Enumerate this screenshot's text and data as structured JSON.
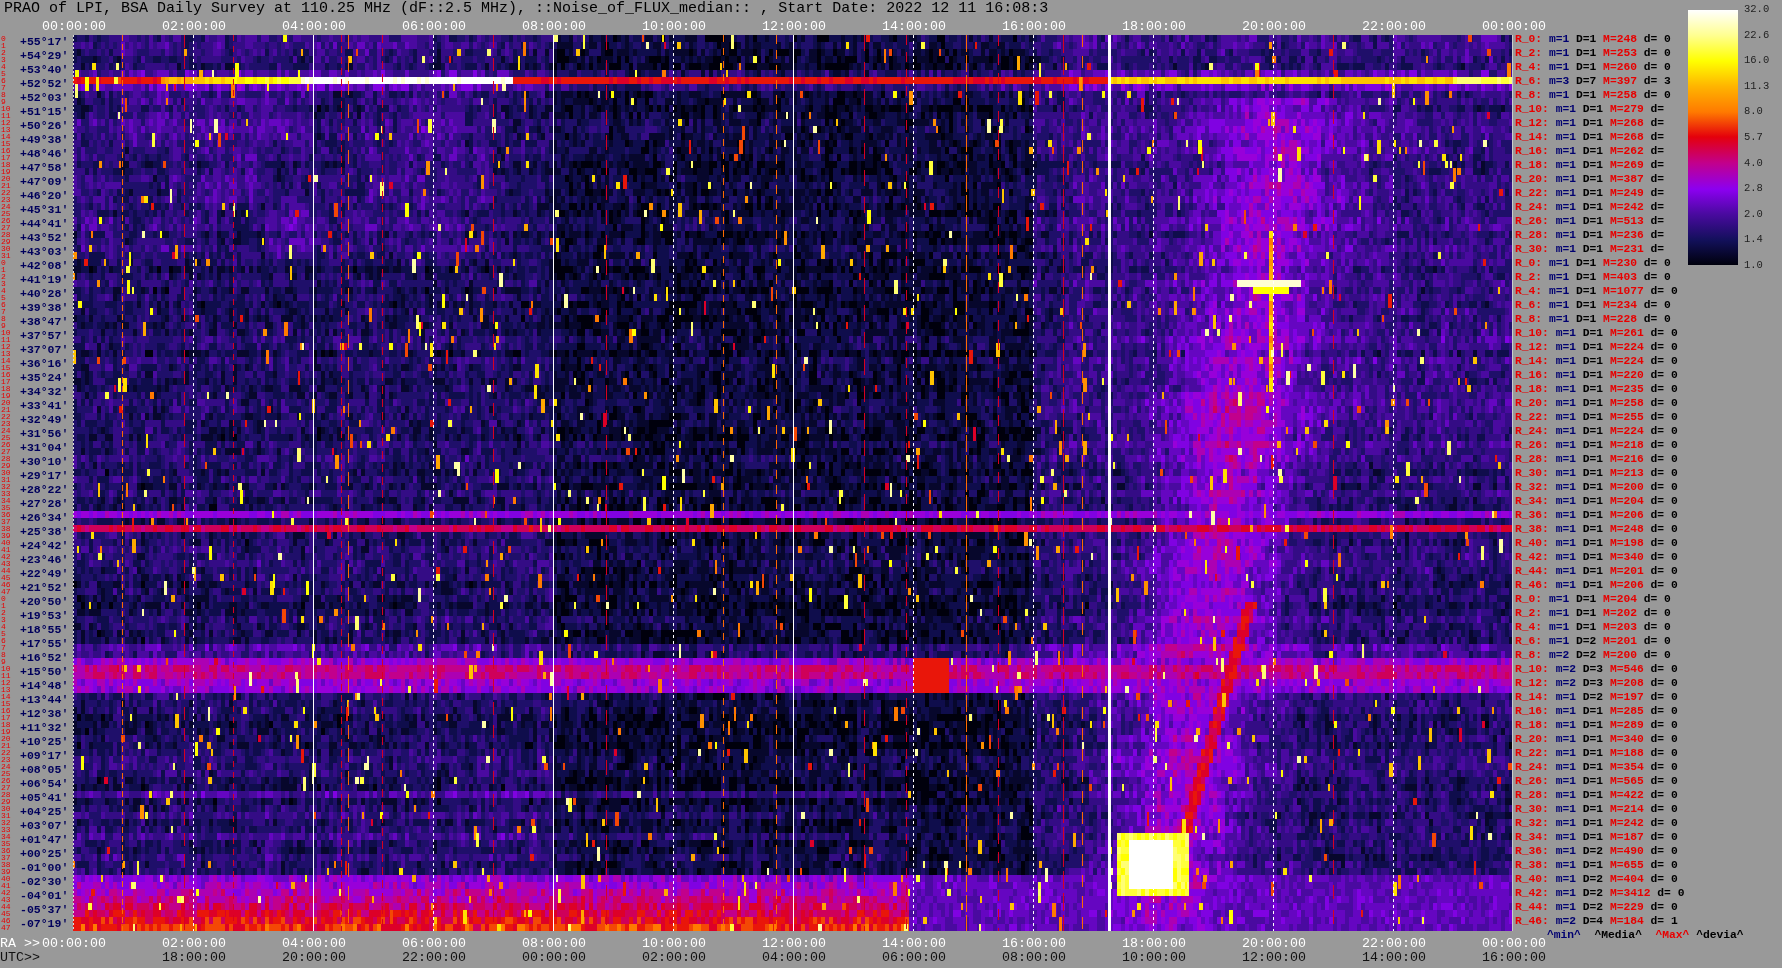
{
  "title": "PRAO of LPI, BSA Daily Survey at 110.25 MHz (dF::2.5 MHz), ::Noise_of_FLUX_median:: , Start Date: 2022 12 11 16:08:3",
  "top_time_axis": [
    "00:00:00",
    "02:00:00",
    "04:00:00",
    "06:00:00",
    "08:00:00",
    "10:00:00",
    "12:00:00",
    "14:00:00",
    "16:00:00",
    "18:00:00",
    "20:00:00",
    "22:00:00",
    "00:00:00"
  ],
  "blocks": [
    {
      "beam_numbers": [
        "0",
        "1",
        "2",
        "3",
        "4",
        "5",
        "6",
        "7",
        "8",
        "9",
        "10",
        "11",
        "12",
        "13",
        "14",
        "15",
        "16",
        "17",
        "18",
        "19",
        "20",
        "21",
        "22",
        "23",
        "24",
        "25",
        "26",
        "27",
        "28",
        "29",
        "30",
        "31"
      ],
      "rows": [
        {
          "declination": "+55°17'",
          "beam": "R_0:",
          "min": "m=1",
          "median": "D=1",
          "max": "M=248",
          "deviation": "d= 0"
        },
        {
          "declination": "+54°29'",
          "beam": "R_2:",
          "min": "m=1",
          "median": "D=1",
          "max": "M=253",
          "deviation": "d= 0"
        },
        {
          "declination": "+53°40'",
          "beam": "R_4:",
          "min": "m=1",
          "median": "D=1",
          "max": "M=260",
          "deviation": "d= 0"
        },
        {
          "declination": "+52°52'",
          "beam": "R_6:",
          "min": "m=3",
          "median": "D=7",
          "max": "M=397",
          "deviation": "d= 3"
        },
        {
          "declination": "+52°03'",
          "beam": "R_8:",
          "min": "m=1",
          "median": "D=1",
          "max": "M=258",
          "deviation": "d= 0"
        },
        {
          "declination": "+51°15'",
          "beam": "R_10:",
          "min": "m=1",
          "median": "D=1",
          "max": "M=279",
          "deviation": "d="
        },
        {
          "declination": "+50°26'",
          "beam": "R_12:",
          "min": "m=1",
          "median": "D=1",
          "max": "M=268",
          "deviation": "d="
        },
        {
          "declination": "+49°38'",
          "beam": "R_14:",
          "min": "m=1",
          "median": "D=1",
          "max": "M=268",
          "deviation": "d="
        },
        {
          "declination": "+48°46'",
          "beam": "R_16:",
          "min": "m=1",
          "median": "D=1",
          "max": "M=262",
          "deviation": "d="
        },
        {
          "declination": "+47°58'",
          "beam": "R_18:",
          "min": "m=1",
          "median": "D=1",
          "max": "M=269",
          "deviation": "d="
        },
        {
          "declination": "+47°09'",
          "beam": "R_20:",
          "min": "m=1",
          "median": "D=1",
          "max": "M=387",
          "deviation": "d="
        },
        {
          "declination": "+46°20'",
          "beam": "R_22:",
          "min": "m=1",
          "median": "D=1",
          "max": "M=249",
          "deviation": "d="
        },
        {
          "declination": "+45°31'",
          "beam": "R_24:",
          "min": "m=1",
          "median": "D=1",
          "max": "M=242",
          "deviation": "d="
        },
        {
          "declination": "+44°41'",
          "beam": "R_26:",
          "min": "m=1",
          "median": "D=1",
          "max": "M=513",
          "deviation": "d="
        },
        {
          "declination": "+43°52'",
          "beam": "R_28:",
          "min": "m=1",
          "median": "D=1",
          "max": "M=236",
          "deviation": "d="
        },
        {
          "declination": "+43°03'",
          "beam": "R_30:",
          "min": "m=1",
          "median": "D=1",
          "max": "M=231",
          "deviation": "d="
        }
      ]
    },
    {
      "beam_numbers": [
        "0",
        "1",
        "2",
        "3",
        "4",
        "5",
        "6",
        "7",
        "8",
        "9",
        "10",
        "11",
        "12",
        "13",
        "14",
        "15",
        "16",
        "17",
        "18",
        "19",
        "20",
        "21",
        "22",
        "23",
        "24",
        "25",
        "26",
        "27",
        "28",
        "29",
        "30",
        "31",
        "32",
        "33",
        "34",
        "35",
        "36",
        "37",
        "38",
        "39",
        "40",
        "41",
        "42",
        "43",
        "44",
        "45",
        "46",
        "47"
      ],
      "rows": [
        {
          "declination": "+42°08'",
          "beam": "R_0:",
          "min": "m=1",
          "median": "D=1",
          "max": "M=230",
          "deviation": "d= 0"
        },
        {
          "declination": "+41°19'",
          "beam": "R_2:",
          "min": "m=1",
          "median": "D=1",
          "max": "M=403",
          "deviation": "d= 0"
        },
        {
          "declination": "+40°28'",
          "beam": "R_4:",
          "min": "m=1",
          "median": "D=1",
          "max": "M=1077",
          "deviation": "d= 0"
        },
        {
          "declination": "+39°38'",
          "beam": "R_6:",
          "min": "m=1",
          "median": "D=1",
          "max": "M=234",
          "deviation": "d= 0"
        },
        {
          "declination": "+38°47'",
          "beam": "R_8:",
          "min": "m=1",
          "median": "D=1",
          "max": "M=228",
          "deviation": "d= 0"
        },
        {
          "declination": "+37°57'",
          "beam": "R_10:",
          "min": "m=1",
          "median": "D=1",
          "max": "M=261",
          "deviation": "d= 0"
        },
        {
          "declination": "+37°07'",
          "beam": "R_12:",
          "min": "m=1",
          "median": "D=1",
          "max": "M=224",
          "deviation": "d= 0"
        },
        {
          "declination": "+36°16'",
          "beam": "R_14:",
          "min": "m=1",
          "median": "D=1",
          "max": "M=224",
          "deviation": "d= 0"
        },
        {
          "declination": "+35°24'",
          "beam": "R_16:",
          "min": "m=1",
          "median": "D=1",
          "max": "M=220",
          "deviation": "d= 0"
        },
        {
          "declination": "+34°32'",
          "beam": "R_18:",
          "min": "m=1",
          "median": "D=1",
          "max": "M=235",
          "deviation": "d= 0"
        },
        {
          "declination": "+33°41'",
          "beam": "R_20:",
          "min": "m=1",
          "median": "D=1",
          "max": "M=258",
          "deviation": "d= 0"
        },
        {
          "declination": "+32°49'",
          "beam": "R_22:",
          "min": "m=1",
          "median": "D=1",
          "max": "M=255",
          "deviation": "d= 0"
        },
        {
          "declination": "+31°56'",
          "beam": "R_24:",
          "min": "m=1",
          "median": "D=1",
          "max": "M=224",
          "deviation": "d= 0"
        },
        {
          "declination": "+31°04'",
          "beam": "R_26:",
          "min": "m=1",
          "median": "D=1",
          "max": "M=218",
          "deviation": "d= 0"
        },
        {
          "declination": "+30°10'",
          "beam": "R_28:",
          "min": "m=1",
          "median": "D=1",
          "max": "M=216",
          "deviation": "d= 0"
        },
        {
          "declination": "+29°17'",
          "beam": "R_30:",
          "min": "m=1",
          "median": "D=1",
          "max": "M=213",
          "deviation": "d= 0"
        },
        {
          "declination": "+28°22'",
          "beam": "R_32:",
          "min": "m=1",
          "median": "D=1",
          "max": "M=200",
          "deviation": "d= 0"
        },
        {
          "declination": "+27°28'",
          "beam": "R_34:",
          "min": "m=1",
          "median": "D=1",
          "max": "M=204",
          "deviation": "d= 0"
        },
        {
          "declination": "+26°34'",
          "beam": "R_36:",
          "min": "m=1",
          "median": "D=1",
          "max": "M=206",
          "deviation": "d= 0"
        },
        {
          "declination": "+25°38'",
          "beam": "R_38:",
          "min": "m=1",
          "median": "D=1",
          "max": "M=248",
          "deviation": "d= 0"
        },
        {
          "declination": "+24°42'",
          "beam": "R_40:",
          "min": "m=1",
          "median": "D=1",
          "max": "M=198",
          "deviation": "d= 0"
        },
        {
          "declination": "+23°46'",
          "beam": "R_42:",
          "min": "m=1",
          "median": "D=1",
          "max": "M=340",
          "deviation": "d= 0"
        },
        {
          "declination": "+22°49'",
          "beam": "R_44:",
          "min": "m=1",
          "median": "D=1",
          "max": "M=201",
          "deviation": "d= 0"
        },
        {
          "declination": "+21°52'",
          "beam": "R_46:",
          "min": "m=1",
          "median": "D=1",
          "max": "M=206",
          "deviation": "d= 0"
        }
      ]
    },
    {
      "beam_numbers": [
        "0",
        "1",
        "2",
        "3",
        "4",
        "5",
        "6",
        "7",
        "8",
        "9",
        "10",
        "11",
        "12",
        "13",
        "14",
        "15",
        "16",
        "17",
        "18",
        "19",
        "20",
        "21",
        "22",
        "23",
        "24",
        "25",
        "26",
        "27",
        "28",
        "29",
        "30",
        "31",
        "32",
        "33",
        "34",
        "35",
        "36",
        "37",
        "38",
        "39",
        "40",
        "41",
        "42",
        "43",
        "44",
        "45",
        "46",
        "47"
      ],
      "rows": [
        {
          "declination": "+20°50'",
          "beam": "R_0:",
          "min": "m=1",
          "median": "D=1",
          "max": "M=204",
          "deviation": "d= 0"
        },
        {
          "declination": "+19°53'",
          "beam": "R_2:",
          "min": "m=1",
          "median": "D=1",
          "max": "M=202",
          "deviation": "d= 0"
        },
        {
          "declination": "+18°55'",
          "beam": "R_4:",
          "min": "m=1",
          "median": "D=1",
          "max": "M=203",
          "deviation": "d= 0"
        },
        {
          "declination": "+17°55'",
          "beam": "R_6:",
          "min": "m=1",
          "median": "D=2",
          "max": "M=201",
          "deviation": "d= 0"
        },
        {
          "declination": "+16°52'",
          "beam": "R_8:",
          "min": "m=2",
          "median": "D=2",
          "max": "M=200",
          "deviation": "d= 0"
        },
        {
          "declination": "+15°50'",
          "beam": "R_10:",
          "min": "m=2",
          "median": "D=3",
          "max": "M=546",
          "deviation": "d= 0"
        },
        {
          "declination": "+14°48'",
          "beam": "R_12:",
          "min": "m=2",
          "median": "D=3",
          "max": "M=208",
          "deviation": "d= 0"
        },
        {
          "declination": "+13°44'",
          "beam": "R_14:",
          "min": "m=1",
          "median": "D=2",
          "max": "M=197",
          "deviation": "d= 0"
        },
        {
          "declination": "+12°38'",
          "beam": "R_16:",
          "min": "m=1",
          "median": "D=1",
          "max": "M=285",
          "deviation": "d= 0"
        },
        {
          "declination": "+11°32'",
          "beam": "R_18:",
          "min": "m=1",
          "median": "D=1",
          "max": "M=289",
          "deviation": "d= 0"
        },
        {
          "declination": "+10°25'",
          "beam": "R_20:",
          "min": "m=1",
          "median": "D=1",
          "max": "M=340",
          "deviation": "d= 0"
        },
        {
          "declination": "+09°17'",
          "beam": "R_22:",
          "min": "m=1",
          "median": "D=1",
          "max": "M=188",
          "deviation": "d= 0"
        },
        {
          "declination": "+08°05'",
          "beam": "R_24:",
          "min": "m=1",
          "median": "D=1",
          "max": "M=354",
          "deviation": "d= 0"
        },
        {
          "declination": "+06°54'",
          "beam": "R_26:",
          "min": "m=1",
          "median": "D=1",
          "max": "M=565",
          "deviation": "d= 0"
        },
        {
          "declination": "+05°41'",
          "beam": "R_28:",
          "min": "m=1",
          "median": "D=1",
          "max": "M=422",
          "deviation": "d= 0"
        },
        {
          "declination": "+04°25'",
          "beam": "R_30:",
          "min": "m=1",
          "median": "D=1",
          "max": "M=214",
          "deviation": "d= 0"
        },
        {
          "declination": "+03°07'",
          "beam": "R_32:",
          "min": "m=1",
          "median": "D=1",
          "max": "M=242",
          "deviation": "d= 0"
        },
        {
          "declination": "+01°47'",
          "beam": "R_34:",
          "min": "m=1",
          "median": "D=1",
          "max": "M=187",
          "deviation": "d= 0"
        },
        {
          "declination": "+00°25'",
          "beam": "R_36:",
          "min": "m=1",
          "median": "D=2",
          "max": "M=490",
          "deviation": "d= 0"
        },
        {
          "declination": "-01°00'",
          "beam": "R_38:",
          "min": "m=1",
          "median": "D=1",
          "max": "M=655",
          "deviation": "d= 0"
        },
        {
          "declination": "-02°30'",
          "beam": "R_40:",
          "min": "m=1",
          "median": "D=2",
          "max": "M=404",
          "deviation": "d= 0"
        },
        {
          "declination": "-04°01'",
          "beam": "R_42:",
          "min": "m=1",
          "median": "D=2",
          "max": "M=3412",
          "deviation": "d= 0"
        },
        {
          "declination": "-05°37'",
          "beam": "R_44:",
          "min": "m=1",
          "median": "D=2",
          "max": "M=229",
          "deviation": "d= 0"
        },
        {
          "declination": "-07°19'",
          "beam": "R_46:",
          "min": "m=2",
          "median": "D=4",
          "max": "M=184",
          "deviation": "d= 1"
        }
      ]
    }
  ],
  "ra_axis": {
    "title": "RA >>",
    "ticks": [
      "00:00:00",
      "02:00:00",
      "04:00:00",
      "06:00:00",
      "08:00:00",
      "10:00:00",
      "12:00:00",
      "14:00:00",
      "16:00:00",
      "18:00:00",
      "20:00:00",
      "22:00:00",
      "00:00:00"
    ]
  },
  "utc_axis": {
    "title": "UTC>>",
    "ticks": [
      "18:00:00",
      "20:00:00",
      "22:00:00",
      "00:00:00",
      "02:00:00",
      "04:00:00",
      "06:00:00",
      "08:00:00",
      "10:00:00",
      "12:00:00",
      "14:00:00",
      "16:00:00"
    ]
  },
  "legend": {
    "min": "^min^",
    "median": "^Media^",
    "max": "^Max^",
    "deviation": "^devia^"
  },
  "colorbar": {
    "ticks": [
      "32.0",
      "22.6",
      "16.0",
      "11.3",
      "8.0",
      "5.7",
      "4.0",
      "2.8",
      "2.0",
      "1.4",
      "1.0"
    ]
  }
}
